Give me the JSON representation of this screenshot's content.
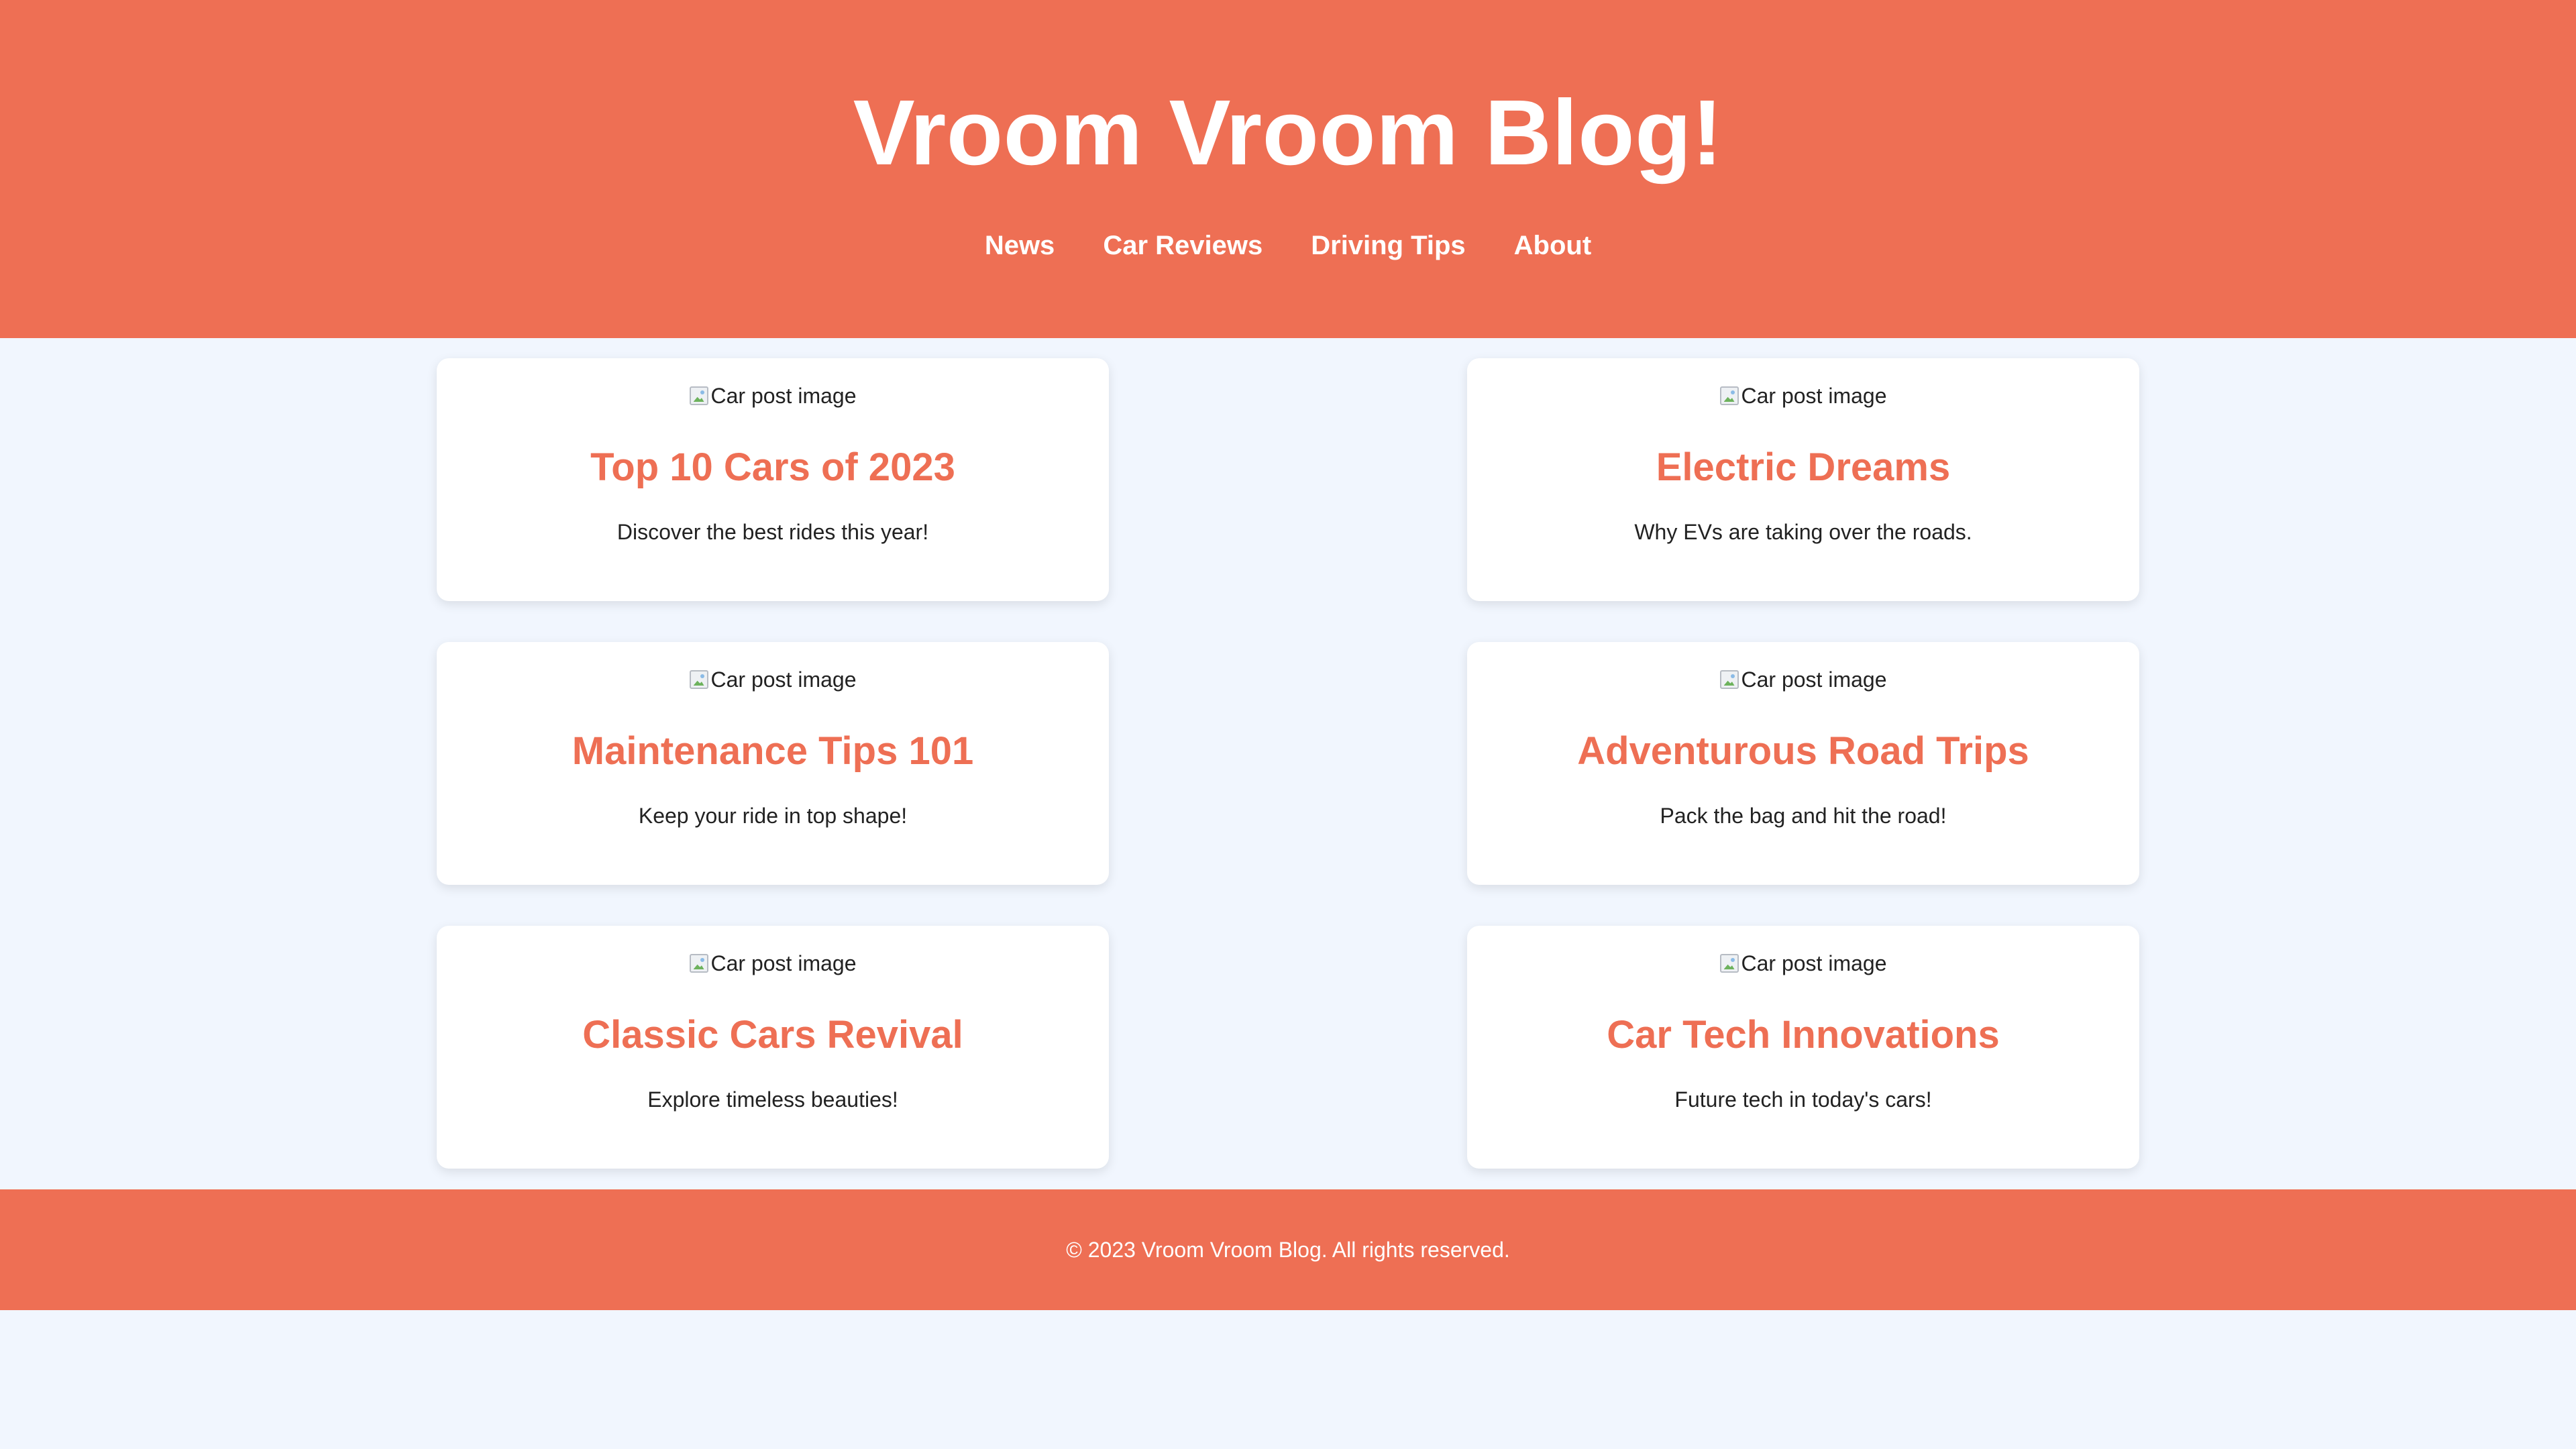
{
  "header": {
    "title": "Vroom Vroom Blog!",
    "nav": [
      {
        "label": "News"
      },
      {
        "label": "Car Reviews"
      },
      {
        "label": "Driving Tips"
      },
      {
        "label": "About"
      }
    ]
  },
  "posts": [
    {
      "image_alt": "Car post image",
      "title": "Top 10 Cars of 2023",
      "description": "Discover the best rides this year!"
    },
    {
      "image_alt": "Car post image",
      "title": "Electric Dreams",
      "description": "Why EVs are taking over the roads."
    },
    {
      "image_alt": "Car post image",
      "title": "Maintenance Tips 101",
      "description": "Keep your ride in top shape!"
    },
    {
      "image_alt": "Car post image",
      "title": "Adventurous Road Trips",
      "description": "Pack the bag and hit the road!"
    },
    {
      "image_alt": "Car post image",
      "title": "Classic Cars Revival",
      "description": "Explore timeless beauties!"
    },
    {
      "image_alt": "Car post image",
      "title": "Car Tech Innovations",
      "description": "Future tech in today's cars!"
    }
  ],
  "footer": {
    "text": "© 2023 Vroom Vroom Blog. All rights reserved."
  },
  "colors": {
    "accent": "#ee6f54",
    "background": "#f1f6fe",
    "card": "#ffffff",
    "text": "#222222"
  },
  "icons": {
    "post_image": "broken-image-icon"
  }
}
